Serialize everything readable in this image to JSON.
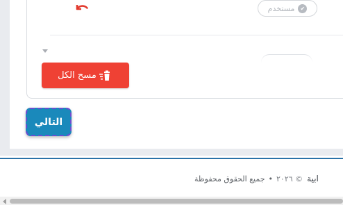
{
  "card": {
    "used_badge": {
      "label": "مستخدم",
      "icon": "check-circle-icon"
    },
    "undo_icon": "undo-icon",
    "clear_all_button": {
      "label": "مسح الكل",
      "icon": "trash-icon",
      "color": "#ef4134"
    }
  },
  "actions": {
    "next_label": "التالي",
    "next_color": "#1a89bb"
  },
  "footer": {
    "brand_partial": "ابية",
    "copyright": "© ٢٠٢٦",
    "rights": "جميع الحقوق محفوظة"
  },
  "colors": {
    "accent_line": "#2a72a8",
    "page_bg": "#e9ebef"
  }
}
